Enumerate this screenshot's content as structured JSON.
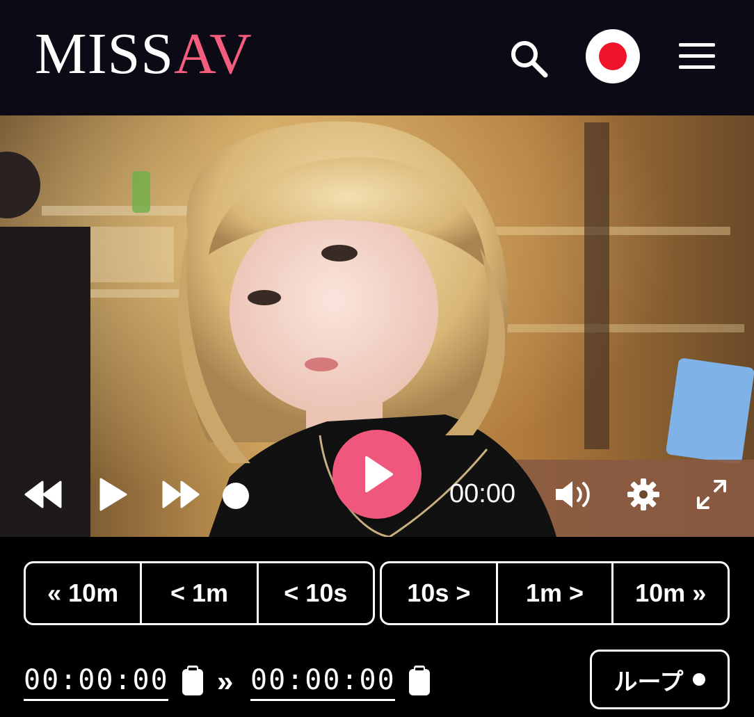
{
  "header": {
    "logo_part1": "MISS",
    "logo_part2": "AV",
    "logo_accent_color": "#f45d7e",
    "icons": [
      "search-icon",
      "live-record-icon",
      "hamburger-menu-icon"
    ]
  },
  "player": {
    "current_time": "00:00",
    "big_play_color": "#f0577c",
    "icons": [
      "rewind-icon",
      "play-icon",
      "fast-forward-icon",
      "progress-dot",
      "volume-icon",
      "settings-icon",
      "fullscreen-icon"
    ]
  },
  "seek": {
    "back": [
      "« 10m",
      "< 1m",
      "< 10s"
    ],
    "forward": [
      "10s >",
      "1m >",
      "10m »"
    ]
  },
  "loop": {
    "start_time": "00:00:00",
    "separator": "»",
    "end_time": "00:00:00",
    "button_label": "ループ"
  }
}
